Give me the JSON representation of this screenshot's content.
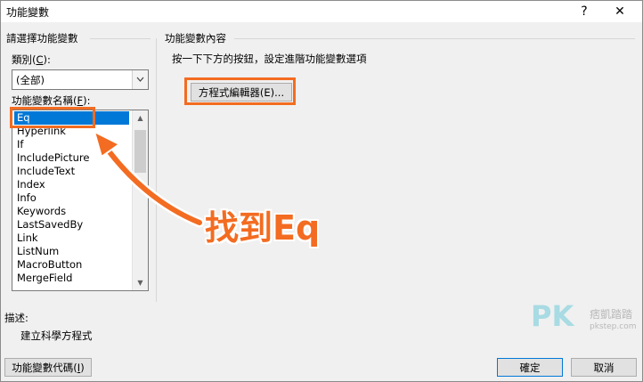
{
  "window": {
    "title": "功能變數",
    "help": "?",
    "close": "✕"
  },
  "left": {
    "group_label": "請選擇功能變數",
    "category_label": "類別(",
    "category_key": "C",
    "category_label_end": "):",
    "category_value": "(全部)",
    "names_label": "功能變數名稱(",
    "names_key": "F",
    "names_label_end": "):",
    "field_names": [
      "Eq",
      "Hyperlink",
      "If",
      "IncludePicture",
      "IncludeText",
      "Index",
      "Info",
      "Keywords",
      "LastSavedBy",
      "Link",
      "ListNum",
      "MacroButton",
      "MergeField"
    ],
    "selected_index": 0
  },
  "right": {
    "group_label": "功能變數內容",
    "instruction": "按一下下方的按鈕，設定進階功能變數選項",
    "editor_button": "方程式編輯器(E)..."
  },
  "description": {
    "label": "描述:",
    "text": "建立科學方程式"
  },
  "footer": {
    "field_codes_prefix": "功能變數代碼(",
    "field_codes_key": "I",
    "field_codes_suffix": ")",
    "ok": "確定",
    "cancel": "取消"
  },
  "annotation": {
    "callout_text": "找到Eq",
    "accent_color": "#f36c21"
  },
  "watermark": {
    "brand": "PK",
    "name": "痞凱踏踏",
    "url": "pkstep.com"
  }
}
